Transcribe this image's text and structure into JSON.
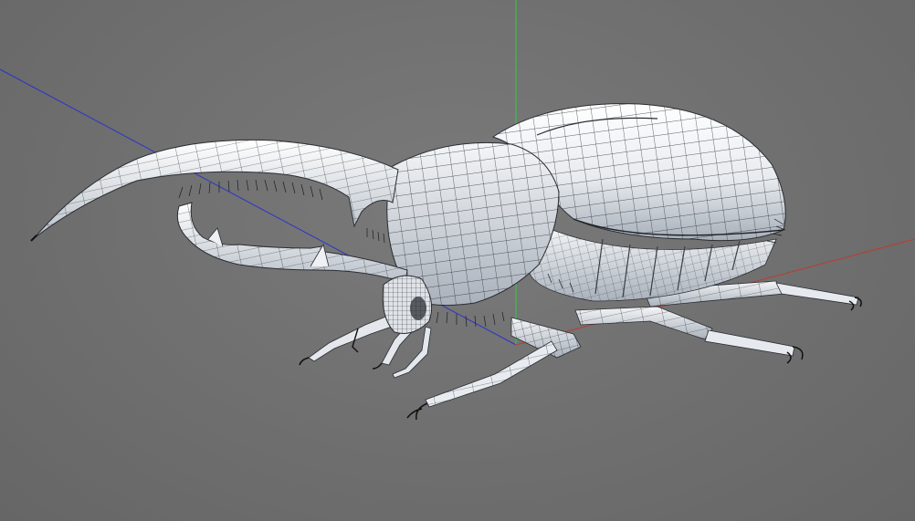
{
  "viewport": {
    "background": "#717171",
    "axes": {
      "x": {
        "color": "#c0392b"
      },
      "y": {
        "color": "#2ecc40"
      },
      "z": {
        "color": "#2a35c8"
      }
    },
    "model": {
      "name": "beetle-wireframe-mesh",
      "display_mode": "shaded-wireframe",
      "surface_color": "#eef0f4",
      "shadow_color": "#9aa3ad",
      "wire_color": "#2a2d33"
    }
  }
}
